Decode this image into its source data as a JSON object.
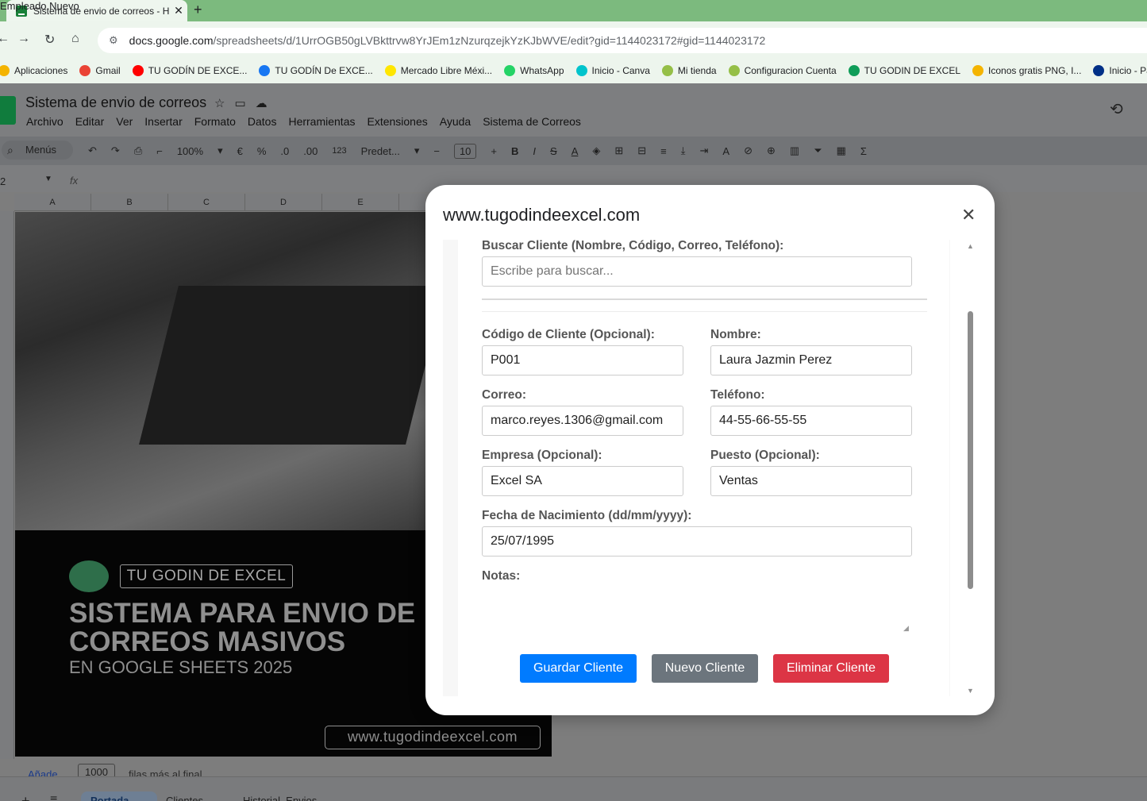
{
  "browser": {
    "tab_title": "Sistema de envio de correos - H",
    "tab_close": "✕",
    "new_tab": "+",
    "url_domain": "docs.google.com",
    "url_rest": "/spreadsheets/d/1UrrOGB50gLVBkttrvw8YrJEm1zNzurqzejkYzKJbWVE/edit?gid=1144023172#gid=1144023172",
    "bookmarks": [
      {
        "label": "Aplicaciones",
        "color": "#f4b400"
      },
      {
        "label": "Gmail",
        "color": "#ea4335"
      },
      {
        "label": "TU GODÍN DE EXCE...",
        "color": "#ff0000"
      },
      {
        "label": "TU GODÍN De EXCE...",
        "color": "#1877f2"
      },
      {
        "label": "Mercado Libre Méxi...",
        "color": "#ffe600"
      },
      {
        "label": "WhatsApp",
        "color": "#25d366"
      },
      {
        "label": "Inicio - Canva",
        "color": "#00c4cc"
      },
      {
        "label": "Mi tienda",
        "color": "#95bf47"
      },
      {
        "label": "Configuracion Cuenta",
        "color": "#95bf47"
      },
      {
        "label": "TU GODIN DE EXCEL",
        "color": "#0f9d58"
      },
      {
        "label": "Iconos gratis PNG, I...",
        "color": "#f4b400"
      },
      {
        "label": "Inicio - PayP",
        "color": "#003087"
      }
    ]
  },
  "sheets": {
    "doc_title": "Sistema de envio de correos",
    "menu": [
      "Archivo",
      "Editar",
      "Ver",
      "Insertar",
      "Formato",
      "Datos",
      "Herramientas",
      "Extensiones",
      "Ayuda",
      "Sistema de Correos"
    ],
    "toolbar": {
      "menus": "Menús",
      "zoom": "100%",
      "currency": "€",
      "percent": "%",
      "dec_less": ".0",
      "dec_more": ".00",
      "format_123": "123",
      "font": "Predet...",
      "font_size": "10"
    },
    "cell_ref": "2",
    "fx": "fx",
    "columns": [
      "A",
      "B",
      "C",
      "D",
      "E"
    ],
    "add_label": "Añade",
    "add_rows": "1000",
    "add_suffix": "filas más al final",
    "sheet_tabs": [
      "Portada",
      "Clientes",
      "Historial_Envios"
    ]
  },
  "banner": {
    "brand": "TU GODIN DE EXCEL",
    "line1": "SISTEMA PARA ENVIO DE",
    "line2": "CORREOS MASIVOS",
    "line3": "EN GOOGLE SHEETS 2025",
    "url": "www.tugodindeexcel.com"
  },
  "dialog": {
    "title": "www.tugodindeexcel.com",
    "close": "✕",
    "search_label": "Buscar Cliente (Nombre, Código, Correo, Teléfono):",
    "search_placeholder": "Escribe para buscar...",
    "codigo_label": "Código de Cliente (Opcional):",
    "codigo_value": "P001",
    "nombre_label": "Nombre:",
    "nombre_value": "Laura Jazmin Perez",
    "correo_label": "Correo:",
    "correo_value": "marco.reyes.1306@gmail.com",
    "telefono_label": "Teléfono:",
    "telefono_value": "44-55-66-55-55",
    "empresa_label": "Empresa (Opcional):",
    "empresa_value": "Excel SA",
    "puesto_label": "Puesto (Opcional):",
    "puesto_value": "Ventas",
    "fecha_label": "Fecha de Nacimiento (dd/mm/yyyy):",
    "fecha_value": "25/07/1995",
    "notas_label": "Notas:",
    "notas_value": "Empleado Nuevo",
    "btn_guardar": "Guardar Cliente",
    "btn_nuevo": "Nuevo Cliente",
    "btn_eliminar": "Eliminar Cliente",
    "colors": {
      "guardar": "#007bff",
      "nuevo": "#6c757d",
      "eliminar": "#dc3545"
    }
  }
}
